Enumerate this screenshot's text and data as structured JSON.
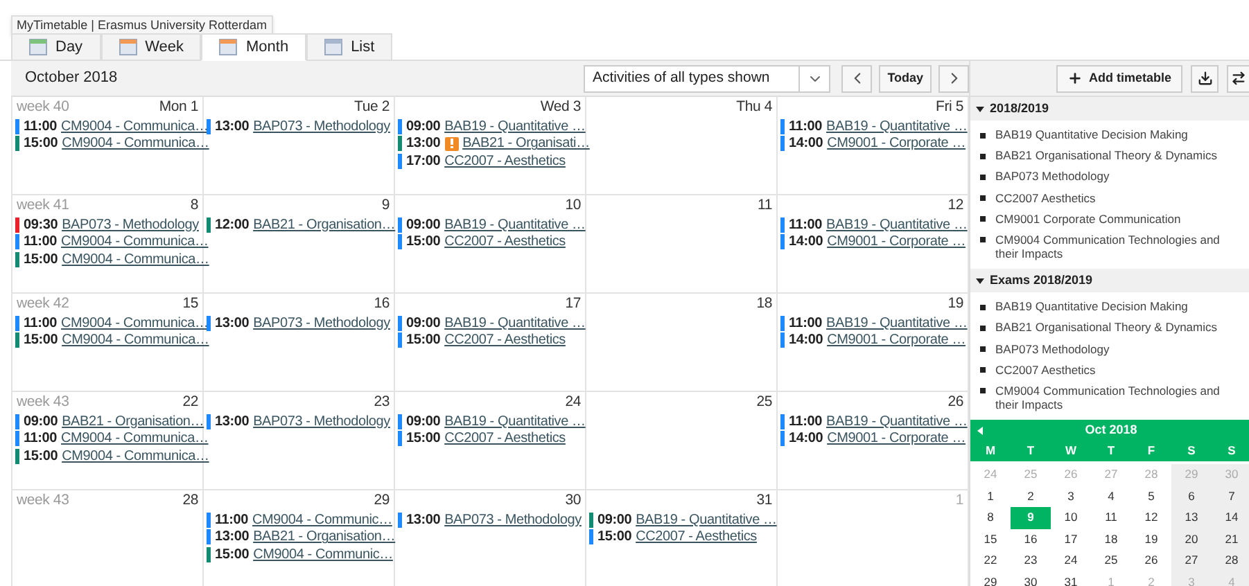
{
  "tooltip": "MyTimetable | Erasmus University Rotterdam",
  "view_tabs": [
    {
      "label": "Day",
      "selected": false
    },
    {
      "label": "Week",
      "selected": false
    },
    {
      "label": "Month",
      "selected": true
    },
    {
      "label": "List",
      "selected": false
    }
  ],
  "toolbar": {
    "period": "October 2018",
    "filter": "Activities of all types shown",
    "today_button": "Today"
  },
  "calendar": {
    "weeks": [
      {
        "label": "week 40",
        "days": [
          {
            "label": "Mon 1",
            "muted": false,
            "events": [
              {
                "time": "11:00",
                "title": "CM9004 - Communica…",
                "color": "#1e88ff",
                "warning": false
              },
              {
                "time": "15:00",
                "title": "CM9004 - Communica…",
                "color": "#138a72",
                "warning": false
              }
            ]
          },
          {
            "label": "Tue 2",
            "muted": false,
            "events": [
              {
                "time": "13:00",
                "title": "BAP073 - Methodology",
                "color": "#1e88ff",
                "warning": false
              }
            ]
          },
          {
            "label": "Wed 3",
            "muted": false,
            "events": [
              {
                "time": "09:00",
                "title": "BAB19 - Quantitative …",
                "color": "#1e88ff",
                "warning": false
              },
              {
                "time": "13:00",
                "title": "BAB21 - Organisati…",
                "color": "#138a72",
                "warning": true
              },
              {
                "time": "17:00",
                "title": "CC2007 - Aesthetics",
                "color": "#1e88ff",
                "warning": false
              }
            ]
          },
          {
            "label": "Thu 4",
            "muted": false
          },
          {
            "label": "Fri 5",
            "muted": false,
            "events": [
              {
                "time": "11:00",
                "title": "BAB19 - Quantitative …",
                "color": "#1e88ff",
                "warning": false
              },
              {
                "time": "14:00",
                "title": "CM9001 - Corporate …",
                "color": "#1e88ff",
                "warning": false
              }
            ]
          }
        ]
      },
      {
        "label": "week 41",
        "days": [
          {
            "label": "8",
            "muted": false,
            "events": [
              {
                "time": "09:30",
                "title": "BAP073 - Methodology",
                "color": "#e8212a",
                "warning": false
              },
              {
                "time": "11:00",
                "title": "CM9004 - Communica…",
                "color": "#1e88ff",
                "warning": false
              },
              {
                "time": "15:00",
                "title": "CM9004 - Communica…",
                "color": "#138a72",
                "warning": false
              }
            ]
          },
          {
            "label": "9",
            "muted": false,
            "events": [
              {
                "time": "12:00",
                "title": "BAB21 - Organisation…",
                "color": "#138a72",
                "warning": false
              }
            ]
          },
          {
            "label": "10",
            "muted": false,
            "events": [
              {
                "time": "09:00",
                "title": "BAB19 - Quantitative …",
                "color": "#1e88ff",
                "warning": false
              },
              {
                "time": "15:00",
                "title": "CC2007 - Aesthetics",
                "color": "#1e88ff",
                "warning": false
              }
            ]
          },
          {
            "label": "11",
            "muted": false
          },
          {
            "label": "12",
            "muted": false,
            "events": [
              {
                "time": "11:00",
                "title": "BAB19 - Quantitative …",
                "color": "#1e88ff",
                "warning": false
              },
              {
                "time": "14:00",
                "title": "CM9001 - Corporate …",
                "color": "#1e88ff",
                "warning": false
              }
            ]
          }
        ]
      },
      {
        "label": "week 42",
        "days": [
          {
            "label": "15",
            "muted": false,
            "events": [
              {
                "time": "11:00",
                "title": "CM9004 - Communica…",
                "color": "#1e88ff",
                "warning": false
              },
              {
                "time": "15:00",
                "title": "CM9004 - Communica…",
                "color": "#138a72",
                "warning": false
              }
            ]
          },
          {
            "label": "16",
            "muted": false,
            "events": [
              {
                "time": "13:00",
                "title": "BAP073 - Methodology",
                "color": "#1e88ff",
                "warning": false
              }
            ]
          },
          {
            "label": "17",
            "muted": false,
            "events": [
              {
                "time": "09:00",
                "title": "BAB19 - Quantitative …",
                "color": "#1e88ff",
                "warning": false
              },
              {
                "time": "15:00",
                "title": "CC2007 - Aesthetics",
                "color": "#1e88ff",
                "warning": false
              }
            ]
          },
          {
            "label": "18",
            "muted": false
          },
          {
            "label": "19",
            "muted": false,
            "events": [
              {
                "time": "11:00",
                "title": "BAB19 - Quantitative …",
                "color": "#1e88ff",
                "warning": false
              },
              {
                "time": "14:00",
                "title": "CM9001 - Corporate …",
                "color": "#1e88ff",
                "warning": false
              }
            ]
          }
        ]
      },
      {
        "label": "week 43",
        "days": [
          {
            "label": "22",
            "muted": false,
            "events": [
              {
                "time": "09:00",
                "title": "BAB21 - Organisation…",
                "color": "#1e88ff",
                "warning": false
              },
              {
                "time": "11:00",
                "title": "CM9004 - Communica…",
                "color": "#1e88ff",
                "warning": false
              },
              {
                "time": "15:00",
                "title": "CM9004 - Communica…",
                "color": "#138a72",
                "warning": false
              }
            ]
          },
          {
            "label": "23",
            "muted": false,
            "events": [
              {
                "time": "13:00",
                "title": "BAP073 - Methodology",
                "color": "#1e88ff",
                "warning": false
              }
            ]
          },
          {
            "label": "24",
            "muted": false,
            "events": [
              {
                "time": "09:00",
                "title": "BAB19 - Quantitative …",
                "color": "#1e88ff",
                "warning": false
              },
              {
                "time": "15:00",
                "title": "CC2007 - Aesthetics",
                "color": "#1e88ff",
                "warning": false
              }
            ]
          },
          {
            "label": "25",
            "muted": false
          },
          {
            "label": "26",
            "muted": false,
            "events": [
              {
                "time": "11:00",
                "title": "BAB19 - Quantitative …",
                "color": "#1e88ff",
                "warning": false
              },
              {
                "time": "14:00",
                "title": "CM9001 - Corporate …",
                "color": "#1e88ff",
                "warning": false
              }
            ]
          }
        ]
      },
      {
        "label": "week 43",
        "days": [
          {
            "label": "28",
            "muted": false
          },
          {
            "label": "29",
            "muted": false,
            "events": [
              {
                "time": "11:00",
                "title": "CM9004 - Communic…",
                "color": "#1e88ff",
                "warning": false
              },
              {
                "time": "13:00",
                "title": "BAB21 - Organisation…",
                "color": "#1e88ff",
                "warning": false
              },
              {
                "time": "15:00",
                "title": "CM9004 - Communic…",
                "color": "#138a72",
                "warning": false
              }
            ]
          },
          {
            "label": "30",
            "muted": false,
            "events": [
              {
                "time": "13:00",
                "title": "BAP073 - Methodology",
                "color": "#1e88ff",
                "warning": false
              }
            ]
          },
          {
            "label": "31",
            "muted": false,
            "events": [
              {
                "time": "09:00",
                "title": "BAB19 - Quantitative …",
                "color": "#138a72",
                "warning": false
              },
              {
                "time": "15:00",
                "title": "CC2007 - Aesthetics",
                "color": "#1e88ff",
                "warning": false
              }
            ]
          },
          {
            "label": "1",
            "muted": true
          }
        ]
      }
    ]
  },
  "sidebar": {
    "add_button": "Add timetable",
    "sections": [
      {
        "title": "2018/2019",
        "expanded": true,
        "items": [
          "BAB19 Quantitative Decision Making",
          "BAB21 Organisational Theory & Dynamics",
          "BAP073 Methodology",
          "CC2007 Aesthetics",
          "CM9001 Corporate Communication",
          "CM9004 Communication Technologies and their Impacts"
        ]
      },
      {
        "title": "Exams 2018/2019",
        "expanded": true,
        "items": [
          "BAB19 Quantitative Decision Making",
          "BAB21 Organisational Theory & Dynamics",
          "BAP073 Methodology",
          "CC2007 Aesthetics",
          "CM9004 Communication Technologies and their Impacts"
        ]
      }
    ],
    "mini_calendar": {
      "title": "Oct 2018",
      "weekdays": [
        "M",
        "T",
        "W",
        "T",
        "F",
        "S",
        "S"
      ],
      "days": [
        {
          "label": "24",
          "muted": true,
          "selected": false
        },
        {
          "label": "25",
          "muted": true,
          "selected": false
        },
        {
          "label": "26",
          "muted": true,
          "selected": false
        },
        {
          "label": "27",
          "muted": true,
          "selected": false
        },
        {
          "label": "28",
          "muted": true,
          "selected": false
        },
        {
          "label": "29",
          "muted": true,
          "selected": false
        },
        {
          "label": "30",
          "muted": true,
          "selected": false
        },
        {
          "label": "1",
          "muted": false,
          "selected": false
        },
        {
          "label": "2",
          "muted": false,
          "selected": false
        },
        {
          "label": "3",
          "muted": false,
          "selected": false
        },
        {
          "label": "4",
          "muted": false,
          "selected": false
        },
        {
          "label": "5",
          "muted": false,
          "selected": false
        },
        {
          "label": "6",
          "muted": false,
          "selected": false
        },
        {
          "label": "7",
          "muted": false,
          "selected": false
        },
        {
          "label": "8",
          "muted": false,
          "selected": false
        },
        {
          "label": "9",
          "muted": false,
          "selected": true
        },
        {
          "label": "10",
          "muted": false,
          "selected": false
        },
        {
          "label": "11",
          "muted": false,
          "selected": false
        },
        {
          "label": "12",
          "muted": false,
          "selected": false
        },
        {
          "label": "13",
          "muted": false,
          "selected": false
        },
        {
          "label": "14",
          "muted": false,
          "selected": false
        },
        {
          "label": "15",
          "muted": false,
          "selected": false
        },
        {
          "label": "16",
          "muted": false,
          "selected": false
        },
        {
          "label": "17",
          "muted": false,
          "selected": false
        },
        {
          "label": "18",
          "muted": false,
          "selected": false
        },
        {
          "label": "19",
          "muted": false,
          "selected": false
        },
        {
          "label": "20",
          "muted": false,
          "selected": false
        },
        {
          "label": "21",
          "muted": false,
          "selected": false
        },
        {
          "label": "22",
          "muted": false,
          "selected": false
        },
        {
          "label": "23",
          "muted": false,
          "selected": false
        },
        {
          "label": "24",
          "muted": false,
          "selected": false
        },
        {
          "label": "25",
          "muted": false,
          "selected": false
        },
        {
          "label": "26",
          "muted": false,
          "selected": false
        },
        {
          "label": "27",
          "muted": false,
          "selected": false
        },
        {
          "label": "28",
          "muted": false,
          "selected": false
        },
        {
          "label": "29",
          "muted": false,
          "selected": false
        },
        {
          "label": "30",
          "muted": false,
          "selected": false
        },
        {
          "label": "31",
          "muted": false,
          "selected": false
        },
        {
          "label": "1",
          "muted": true,
          "selected": false
        },
        {
          "label": "2",
          "muted": true,
          "selected": false
        },
        {
          "label": "3",
          "muted": true,
          "selected": false
        },
        {
          "label": "4",
          "muted": true,
          "selected": false
        }
      ]
    }
  }
}
